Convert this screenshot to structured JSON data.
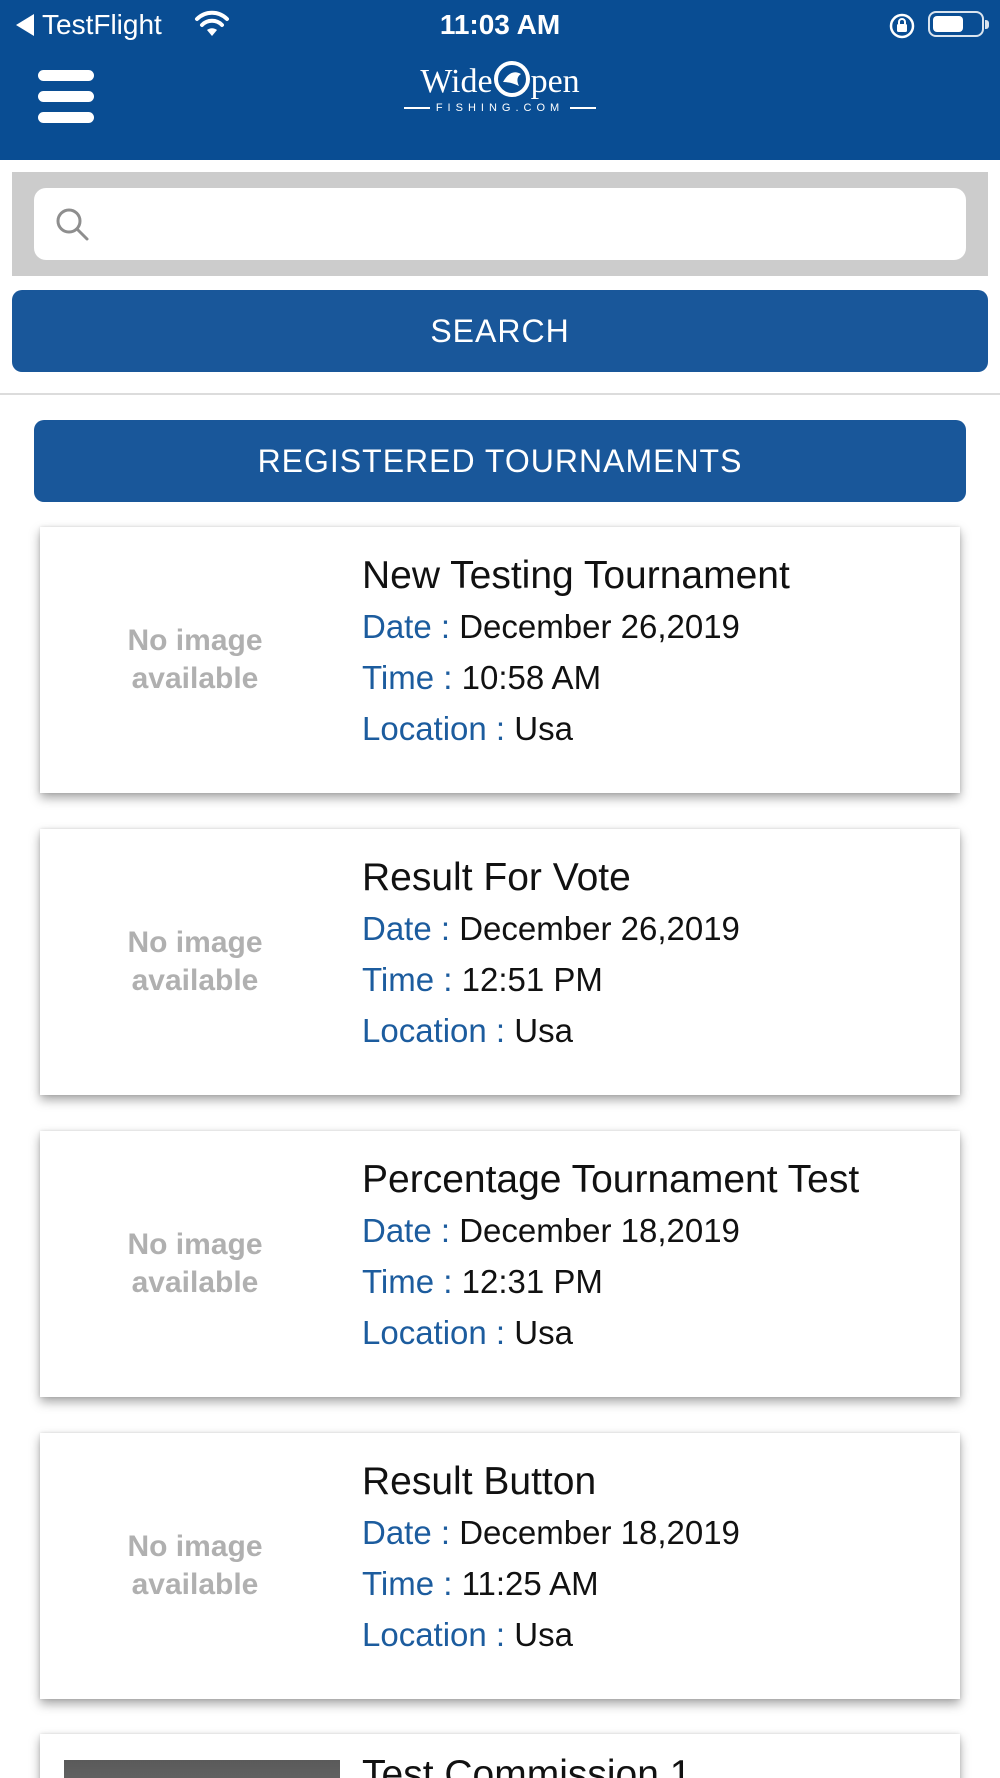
{
  "status_bar": {
    "back_label": "TestFlight",
    "time": "11:03 AM"
  },
  "header": {
    "logo_main_left": "Wide",
    "logo_main_right": "pen",
    "logo_sub": "FISHING.COM"
  },
  "search": {
    "placeholder": "",
    "value": "",
    "button_label": "SEARCH"
  },
  "registered_label": "REGISTERED TOURNAMENTS",
  "labels": {
    "date": "Date : ",
    "time": "Time : ",
    "location": "Location : ",
    "no_image": "No image available"
  },
  "tournaments": [
    {
      "name": "New Testing Tournament",
      "date": "December 26,2019",
      "time": "10:58 AM",
      "location": "Usa"
    },
    {
      "name": "Result For Vote",
      "date": "December 26,2019",
      "time": "12:51 PM",
      "location": "Usa"
    },
    {
      "name": "Percentage Tournament Test",
      "date": "December 18,2019",
      "time": "12:31 PM",
      "location": "Usa"
    },
    {
      "name": "Result Button",
      "date": "December 18,2019",
      "time": "11:25 AM",
      "location": "Usa"
    },
    {
      "name": "Test Commission 1"
    }
  ],
  "colors": {
    "header_bg": "#094d93",
    "button_bg": "#19579a",
    "label_blue": "#1c5c9e",
    "no_image_gray": "#b0b0b0"
  }
}
